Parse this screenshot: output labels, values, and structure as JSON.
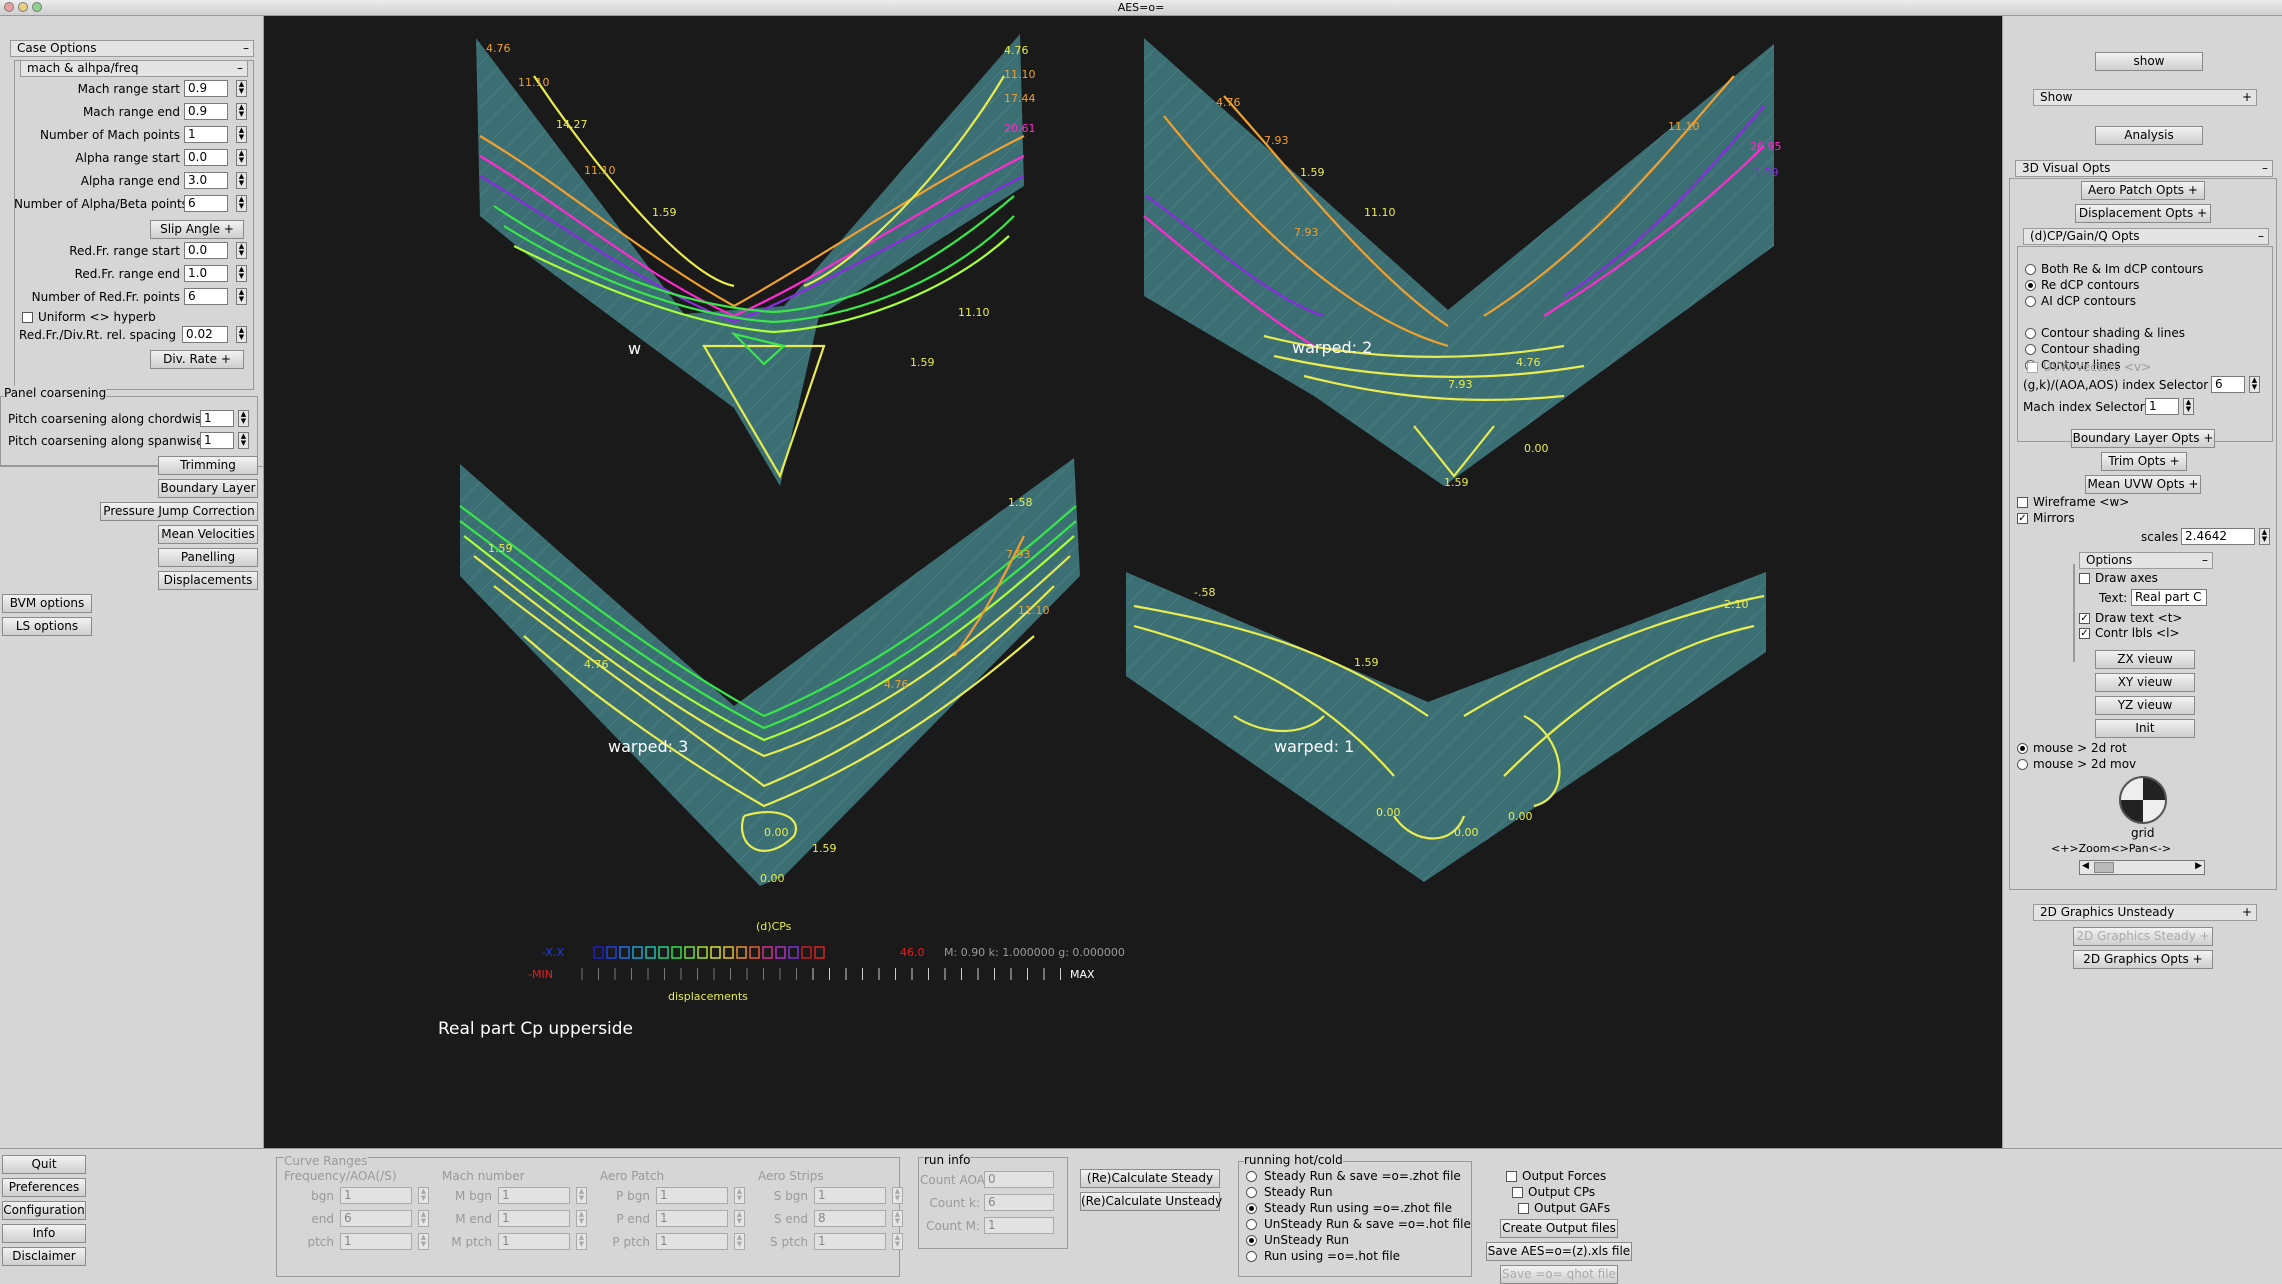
{
  "window_title": "AES=o=",
  "left": {
    "case_options": "Case Options",
    "mach_group": "mach & alhpa/freq",
    "rows": [
      {
        "label": "Mach range start",
        "value": "0.9"
      },
      {
        "label": "Mach range end",
        "value": "0.9"
      },
      {
        "label": "Number of Mach points",
        "value": "1"
      },
      {
        "label": "Alpha range start",
        "value": "0.0"
      },
      {
        "label": "Alpha range end",
        "value": "3.0"
      },
      {
        "label": "Number of Alpha/Beta points",
        "value": "6"
      }
    ],
    "slip_angle": "Slip Angle",
    "rows2": [
      {
        "label": "Red.Fr. range start",
        "value": "0.0"
      },
      {
        "label": "Red.Fr. range end",
        "value": "1.0"
      },
      {
        "label": "Number of Red.Fr. points",
        "value": "6"
      }
    ],
    "uniform": "Uniform <> hyperb",
    "spacing_label": "Red.Fr./Div.Rt. rel. spacing",
    "spacing_value": "0.02",
    "div_rate": "Div. Rate",
    "panel_coarsening": "Panel coarsening",
    "chordwise_label": "Pitch coarsening along chordwise",
    "chordwise_value": "1",
    "spanwise_label": "Pitch coarsening along  spanwise",
    "spanwise_value": "1",
    "buttons": [
      "Trimming",
      "Boundary Layer",
      "Pressure Jump Correction",
      "Mean Velocities",
      "Panelling",
      "Displacements"
    ],
    "bvm": "BVM options",
    "ls": "LS  options"
  },
  "canvas": {
    "views": [
      {
        "label": "w"
      },
      {
        "label": "warped:  2"
      },
      {
        "label": "warped:  3"
      },
      {
        "label": "warped:  1"
      }
    ],
    "contour_values": [
      "4.76",
      "11.10",
      "14.27",
      "17.44",
      "20.61",
      "1.59",
      "7.93",
      "0.00",
      "2.10",
      "26.95",
      "-.58",
      "1.58"
    ],
    "legend_title": "(d)CPs",
    "legend_neg": "-X.X",
    "legend_pos": "46.0",
    "legend_info": "M: 0.90 k: 1.000000 g: 0.000000",
    "legend_min": "-MIN",
    "legend_max": "MAX",
    "legend_disp": "displacements",
    "caption": "Real part Cp  upperside",
    "colors": {
      "surface": "#3b6f73",
      "contour_yellow": "#e8ec50",
      "contour_green": "#39e64a",
      "contour_orange": "#f0a030",
      "contour_magenta": "#ff2ad0",
      "contour_purple": "#8a2be2",
      "mesh": "#557f82"
    }
  },
  "right": {
    "show_btn": "show",
    "show_hdr": "Show",
    "analysis_btn": "Analysis",
    "visual_opts": "3D Visual Opts",
    "aero_patch": "Aero Patch Opts",
    "displacement": "Displacement  Opts",
    "dcp_opts": "(d)CP/Gain/Q  Opts",
    "radios1": [
      {
        "label": "Both Re & Im dCP contours",
        "on": false
      },
      {
        "label": "Re dCP contours",
        "on": true
      },
      {
        "label": "AI dCP contours",
        "on": false
      }
    ],
    "radios2": [
      {
        "label": "Contour shading & lines",
        "on": false
      },
      {
        "label": "Contour shading",
        "on": false
      },
      {
        "label": "Contour lines",
        "on": true
      }
    ],
    "uvw": "UVW Vectors <v>",
    "index_sel_label": "(g,k)/(AOA,AOS) index Selector",
    "index_sel_value": "6",
    "mach_sel_label": "Mach index Selector",
    "mach_sel_value": "1",
    "boundary": "Boundary Layer Opts",
    "trim": "Trim  Opts",
    "mean_uvw": "Mean UVW Opts",
    "wireframe": "Wireframe <w>",
    "mirrors": "Mirrors",
    "scales_label": "scales",
    "scales_value": "2.4642",
    "options": "Options",
    "draw_axes": "Draw axes",
    "text_label": "Text:",
    "text_value": "Real part C",
    "draw_text": "Draw  text <t>",
    "contr_lbls": "Contr lbls <l>",
    "zx": "ZX vieuw",
    "xy": "XY vieuw",
    "yz": "YZ vieuw",
    "init": "Init",
    "mouse1": "mouse > 2d rot",
    "mouse2": "mouse > 2d mov",
    "grid": "grid",
    "zoom": "<+>Zoom<>Pan<->",
    "g2d_unsteady": "2D Graphics Unsteady",
    "g2d_steady": "2D Graphics Steady",
    "g2d_opts": "2D Graphics Opts"
  },
  "bottom": {
    "left_buttons": [
      "Quit",
      "Preferences",
      "Configuration",
      "Info",
      "Disclaimer"
    ],
    "curve_ranges": "Curve Ranges",
    "col_heads": [
      "Frequency/AOA(/S)",
      "Mach number",
      "Aero Patch",
      "Aero Strips"
    ],
    "cols": [
      [
        {
          "l": "bgn",
          "v": "1"
        },
        {
          "l": "end",
          "v": "6"
        },
        {
          "l": "ptch",
          "v": "1"
        }
      ],
      [
        {
          "l": "M bgn",
          "v": "1"
        },
        {
          "l": "M end",
          "v": "1"
        },
        {
          "l": "M ptch",
          "v": "1"
        }
      ],
      [
        {
          "l": "P bgn",
          "v": "1"
        },
        {
          "l": "P end",
          "v": "1"
        },
        {
          "l": "P ptch",
          "v": "1"
        }
      ],
      [
        {
          "l": "S bgn",
          "v": "1"
        },
        {
          "l": "S end",
          "v": "8"
        },
        {
          "l": "S ptch",
          "v": "1"
        }
      ]
    ],
    "run_info": "run info",
    "run_rows": [
      {
        "l": "Count AOA:",
        "v": "0"
      },
      {
        "l": "Count k:",
        "v": "6"
      },
      {
        "l": "Count M:",
        "v": "1"
      }
    ],
    "calc_steady": "(Re)Calculate Steady",
    "calc_unsteady": "(Re)Calculate Unsteady",
    "running": "running hot/cold",
    "run_opts": [
      {
        "label": "Steady Run & save =o=.zhot file",
        "on": false
      },
      {
        "label": "Steady Run",
        "on": false
      },
      {
        "label": "Steady Run  using =o=.zhot file",
        "on": true
      },
      {
        "label": "UnSteady Run & save =o=.hot file",
        "on": false
      },
      {
        "label": "UnSteady Run",
        "on": true
      },
      {
        "label": "      Run  using =o=.hot file",
        "on": false
      }
    ],
    "outputs": [
      "Output Forces",
      "Output CPs",
      "Output GAFs"
    ],
    "create_out": "Create Output files",
    "save_xls": "Save AES=o=(z).xls file",
    "save_qhot": "Save =o= qhot file"
  }
}
